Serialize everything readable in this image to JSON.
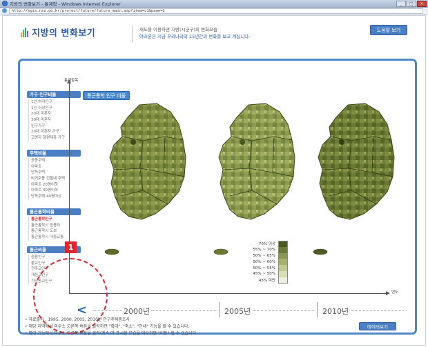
{
  "window": {
    "title": "지방의 변화보기 - 통계청 - Windows Internet Explorer",
    "url": "http://sgis.nso.go.kr/project/future/future_main.asp?item=c1&page=2"
  },
  "header": {
    "logo_text": "지방의 변화보기",
    "desc_line1": "재도를 이용하면 지방(시군구)의 변화모습",
    "desc_line2": "여러분은 지금 우리나라의 15년간의 변화를 보고 계십니다.",
    "help_label": "도움말 보기"
  },
  "chart": {
    "title": "통근통학 인구 비율",
    "ylabel": "통계항목",
    "xlabel": "연도"
  },
  "sidebar": {
    "groups": [
      {
        "label": "가구·인구비율",
        "items": [
          "1인 여자인구",
          "1인 이상인구",
          "20대 미혼자",
          "30대 미혼자",
          "인구가구",
          "20대 미혼자 가구",
          "고령자 형편제휴 가구"
        ]
      },
      {
        "label": "주택비율",
        "items": [
          "공동주택",
          "아파트",
          "단독주택",
          "비거주용 건물내 주택",
          "아파트 20평이하",
          "아파트 40평이하",
          "단독주택 40평이상"
        ]
      },
      {
        "label": "통근통학비율",
        "items": [
          "통근통학인구",
          "통근통학시 승용차",
          "통근통학시 도보",
          "통근통학시 대중교통"
        ],
        "selected": 0
      },
      {
        "label": "통근비율",
        "items": [
          "승용인구",
          "불교인구",
          "천주교인구",
          "개신교인구",
          "기타종교인구"
        ]
      }
    ]
  },
  "legend": {
    "entries": [
      {
        "label": "70% 이상",
        "color": "#4b5a25"
      },
      {
        "label": "55% ~ 70%",
        "color": "#6b7a38"
      },
      {
        "label": "50% ~ 65%",
        "color": "#8a9850"
      },
      {
        "label": "50% ~ 60%",
        "color": "#a6b16c"
      },
      {
        "label": "50% ~ 55%",
        "color": "#c1c98f"
      },
      {
        "label": "45% ~ 50%",
        "color": "#d9ddb6"
      },
      {
        "label": "45% 미만",
        "color": "#eeefdd"
      }
    ]
  },
  "timeline": {
    "prev_label": "<",
    "years": [
      "2000년",
      "2005년",
      "2010년"
    ]
  },
  "annotation": {
    "marker": "1"
  },
  "notes": [
    "• 자료출처 : 1995, 2000, 2005, 2010년 인구주택총조사",
    "• 해당 지역에서 마우스 오른쪽 버튼을 클릭하면 \"확대\", \"축소\", \"인쇄\" 기능을 할 수 있습니다.",
    "• 확대 기능에서 마우스 오른쪽 버튼을 클릭(계속)가 표시된 모습을 태우하면 \"이동\" 할 수 있습니다."
  ],
  "data_button_label": "데이터보기"
}
